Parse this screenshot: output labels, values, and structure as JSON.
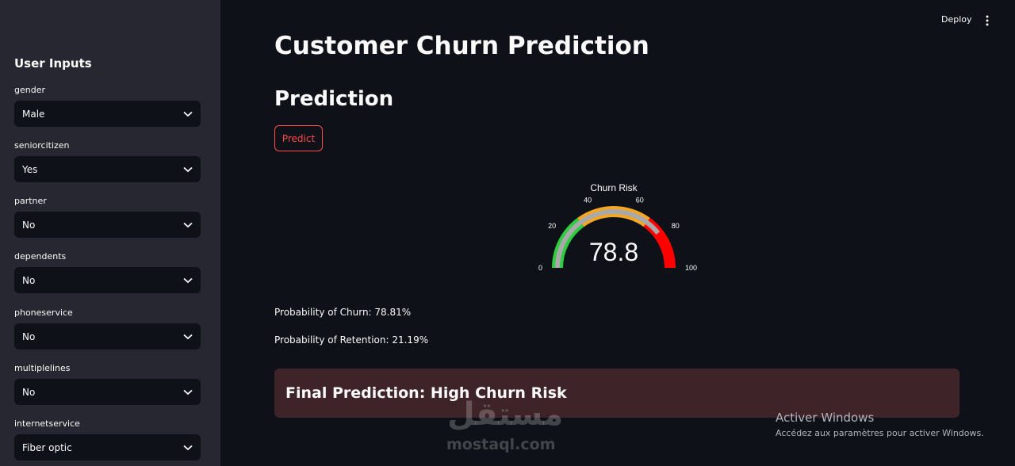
{
  "sidebar": {
    "title": "User Inputs",
    "fields": [
      {
        "label": "gender",
        "value": "Male"
      },
      {
        "label": "seniorcitizen",
        "value": "Yes"
      },
      {
        "label": "partner",
        "value": "No"
      },
      {
        "label": "dependents",
        "value": "No"
      },
      {
        "label": "phoneservice",
        "value": "No"
      },
      {
        "label": "multiplelines",
        "value": "No"
      },
      {
        "label": "internetservice",
        "value": "Fiber optic"
      }
    ]
  },
  "header": {
    "deploy_label": "Deploy",
    "menu_icon": "vertical-dots-icon"
  },
  "main": {
    "title": "Customer Churn Prediction",
    "section_title": "Prediction",
    "predict_label": "Predict",
    "probability_churn": "Probability of Churn: 78.81%",
    "probability_retention": "Probability of Retention: 21.19%",
    "final_prediction": "Final Prediction: High Churn Risk"
  },
  "chart_data": {
    "type": "gauge",
    "title": "Churn Risk",
    "value": 78.8,
    "value_text": "78.8",
    "range": [
      0,
      100
    ],
    "ticks": [
      "0",
      "20",
      "40",
      "60",
      "80",
      "100"
    ],
    "steps": [
      {
        "range": [
          0,
          30
        ],
        "color": "#2ecc40"
      },
      {
        "range": [
          30,
          70
        ],
        "color": "#f5a623"
      },
      {
        "range": [
          70,
          100
        ],
        "color": "#ff0000"
      }
    ],
    "bar_color": "#a9a9a9"
  },
  "overlay": {
    "activate_title": "Activer Windows",
    "activate_sub": "Accédez aux paramètres pour activer Windows.",
    "watermark_arabic": "مستقل",
    "watermark_latin": "mostaql.com"
  },
  "colors": {
    "background": "#0e1117",
    "sidebar": "#262730",
    "accent": "#ff4b4b",
    "result_box": "#3e2428"
  }
}
